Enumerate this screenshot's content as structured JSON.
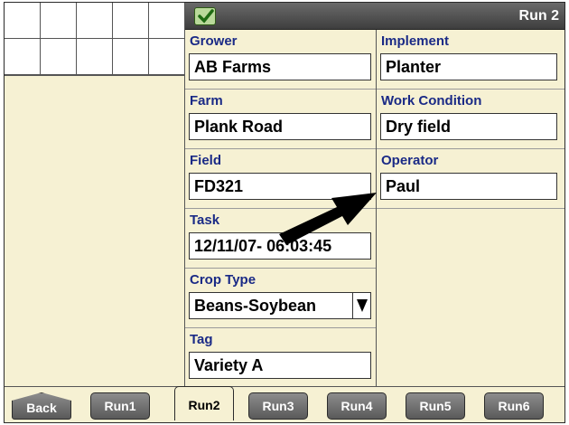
{
  "header": {
    "title": "Run 2",
    "status_icon": "check-icon"
  },
  "form": {
    "left": [
      {
        "label": "Grower",
        "value": "AB Farms"
      },
      {
        "label": "Farm",
        "value": "Plank Road"
      },
      {
        "label": "Field",
        "value": "FD321"
      },
      {
        "label": "Task",
        "value": "12/11/07- 06:03:45"
      },
      {
        "label": "Crop Type",
        "value": "Beans-Soybean"
      },
      {
        "label": "Tag",
        "value": "Variety A"
      }
    ],
    "right": [
      {
        "label": "Implement",
        "value": "Planter"
      },
      {
        "label": "Work Condition",
        "value": "Dry field"
      },
      {
        "label": "Operator",
        "value": "Paul"
      }
    ]
  },
  "tabs": [
    {
      "label": "Back"
    },
    {
      "label": "Run1"
    },
    {
      "label": "Run2",
      "active": true
    },
    {
      "label": "Run3"
    },
    {
      "label": "Run4"
    },
    {
      "label": "Run5"
    },
    {
      "label": "Run6"
    }
  ]
}
